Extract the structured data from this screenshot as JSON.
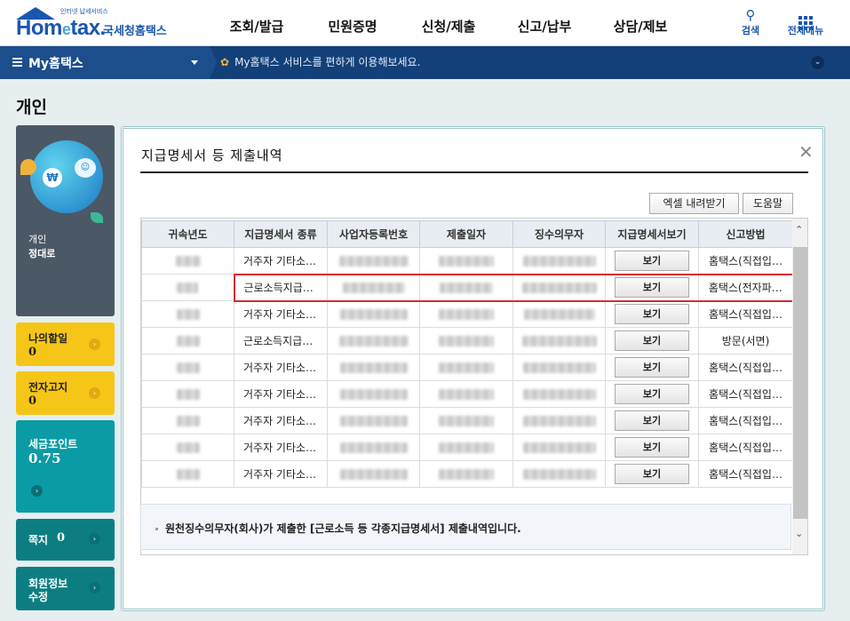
{
  "header": {
    "logo_small": "인터넷 납세서비스",
    "logo_pre": "Hom",
    "logo_e": "e",
    "logo_post": "tax.",
    "logo_sub": "국세청홈택스",
    "nav": [
      "조회/발급",
      "민원증명",
      "신청/제출",
      "신고/납부",
      "상담/제보"
    ],
    "search_label": "검색",
    "menu_label": "전체메뉴"
  },
  "subbar": {
    "my_menu": "My홈택스",
    "notice": "My홈택스 서비스를 편하게 이용해보세요."
  },
  "page_title": "개인",
  "profile": {
    "type": "개인",
    "name": "정대로"
  },
  "cards": {
    "todo": {
      "label": "나의할일",
      "count": "0"
    },
    "notice": {
      "label": "전자고지",
      "count": "0"
    },
    "points": {
      "label": "세금포인트",
      "count": "0.75"
    },
    "memo": {
      "label": "쪽지",
      "count": "0"
    },
    "member": {
      "label_line1": "회원정보",
      "label_line2": "수정"
    }
  },
  "panel": {
    "title": "지급명세서 등 제출내역",
    "excel_button": "엑셀 내려받기",
    "help_button": "도움말",
    "columns": [
      "귀속년도",
      "지급명세서 종류",
      "사업자등록번호",
      "제출일자",
      "징수의무자",
      "지급명세서보기",
      "신고방법"
    ],
    "view_label": "보기",
    "rows": [
      {
        "type": "거주자 기타소…",
        "method": "홈택스(직접입…"
      },
      {
        "type": "근로소득지급…",
        "method": "홈택스(전자파…"
      },
      {
        "type": "거주자 기타소…",
        "method": "홈택스(직접입…"
      },
      {
        "type": "근로소득지급…",
        "method": "방문(서면)"
      },
      {
        "type": "거주자 기타소…",
        "method": "홈택스(직접입…"
      },
      {
        "type": "거주자 기타소…",
        "method": "홈택스(직접입…"
      },
      {
        "type": "거주자 기타소…",
        "method": "홈택스(직접입…"
      },
      {
        "type": "거주자 기타소…",
        "method": "홈택스(직접입…"
      },
      {
        "type": "거주자 기타소…",
        "method": "홈택스(직접입…"
      }
    ],
    "info": "원천징수의무자(회사)가 제출한 [근로소득 등 각종지급명세서] 제출내역입니다."
  },
  "colors": {
    "brand": "#1a56b0",
    "subbar": "#14407a",
    "highlight": "#d62d2d"
  }
}
